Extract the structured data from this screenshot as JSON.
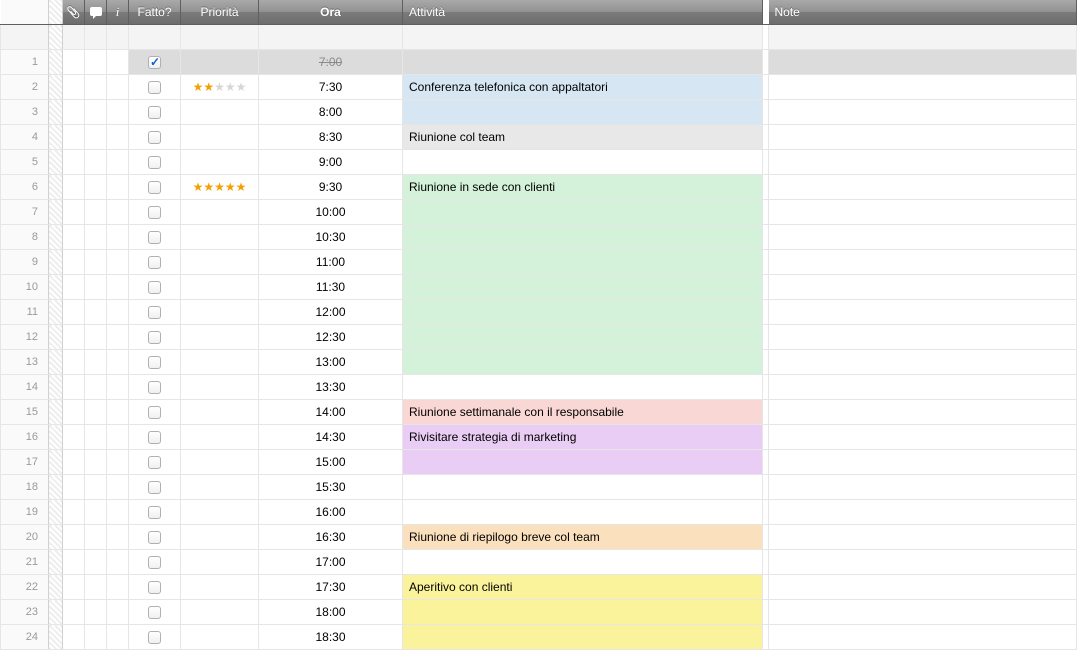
{
  "headers": {
    "done": "Fatto?",
    "priority": "Priorità",
    "time": "Ora",
    "activity": "Attività",
    "notes": "Note"
  },
  "rows": [
    {
      "n": 1,
      "checked": true,
      "stars": 0,
      "time": "7:00",
      "strike": true,
      "activity": "",
      "color": "gray",
      "note": ""
    },
    {
      "n": 2,
      "checked": false,
      "stars": 2,
      "time": "7:30",
      "strike": false,
      "activity": "Conferenza telefonica con appaltatori",
      "color": "blue",
      "note": ""
    },
    {
      "n": 3,
      "checked": false,
      "stars": 0,
      "time": "8:00",
      "strike": false,
      "activity": "",
      "color": "blue",
      "note": ""
    },
    {
      "n": 4,
      "checked": false,
      "stars": 0,
      "time": "8:30",
      "strike": false,
      "activity": "Riunione col team",
      "color": "ltgray",
      "note": ""
    },
    {
      "n": 5,
      "checked": false,
      "stars": 0,
      "time": "9:00",
      "strike": false,
      "activity": "",
      "color": "",
      "note": ""
    },
    {
      "n": 6,
      "checked": false,
      "stars": 5,
      "time": "9:30",
      "strike": false,
      "activity": "Riunione in sede con clienti",
      "color": "green",
      "note": ""
    },
    {
      "n": 7,
      "checked": false,
      "stars": 0,
      "time": "10:00",
      "strike": false,
      "activity": "",
      "color": "green",
      "note": ""
    },
    {
      "n": 8,
      "checked": false,
      "stars": 0,
      "time": "10:30",
      "strike": false,
      "activity": "",
      "color": "green",
      "note": ""
    },
    {
      "n": 9,
      "checked": false,
      "stars": 0,
      "time": "11:00",
      "strike": false,
      "activity": "",
      "color": "green",
      "note": ""
    },
    {
      "n": 10,
      "checked": false,
      "stars": 0,
      "time": "11:30",
      "strike": false,
      "activity": "",
      "color": "green",
      "note": ""
    },
    {
      "n": 11,
      "checked": false,
      "stars": 0,
      "time": "12:00",
      "strike": false,
      "activity": "",
      "color": "green",
      "note": ""
    },
    {
      "n": 12,
      "checked": false,
      "stars": 0,
      "time": "12:30",
      "strike": false,
      "activity": "",
      "color": "green",
      "note": ""
    },
    {
      "n": 13,
      "checked": false,
      "stars": 0,
      "time": "13:00",
      "strike": false,
      "activity": "",
      "color": "green",
      "note": ""
    },
    {
      "n": 14,
      "checked": false,
      "stars": 0,
      "time": "13:30",
      "strike": false,
      "activity": "",
      "color": "",
      "note": ""
    },
    {
      "n": 15,
      "checked": false,
      "stars": 0,
      "time": "14:00",
      "strike": false,
      "activity": "Riunione settimanale con il responsabile",
      "color": "pink",
      "note": ""
    },
    {
      "n": 16,
      "checked": false,
      "stars": 0,
      "time": "14:30",
      "strike": false,
      "activity": "Rivisitare strategia di marketing",
      "color": "purple",
      "note": ""
    },
    {
      "n": 17,
      "checked": false,
      "stars": 0,
      "time": "15:00",
      "strike": false,
      "activity": "",
      "color": "purple",
      "note": ""
    },
    {
      "n": 18,
      "checked": false,
      "stars": 0,
      "time": "15:30",
      "strike": false,
      "activity": "",
      "color": "",
      "note": ""
    },
    {
      "n": 19,
      "checked": false,
      "stars": 0,
      "time": "16:00",
      "strike": false,
      "activity": "",
      "color": "",
      "note": ""
    },
    {
      "n": 20,
      "checked": false,
      "stars": 0,
      "time": "16:30",
      "strike": false,
      "activity": "Riunione di riepilogo breve col team",
      "color": "orange",
      "note": ""
    },
    {
      "n": 21,
      "checked": false,
      "stars": 0,
      "time": "17:00",
      "strike": false,
      "activity": "",
      "color": "",
      "note": ""
    },
    {
      "n": 22,
      "checked": false,
      "stars": 0,
      "time": "17:30",
      "strike": false,
      "activity": "Aperitivo con clienti",
      "color": "yellow",
      "note": ""
    },
    {
      "n": 23,
      "checked": false,
      "stars": 0,
      "time": "18:00",
      "strike": false,
      "activity": "",
      "color": "yellow",
      "note": ""
    },
    {
      "n": 24,
      "checked": false,
      "stars": 0,
      "time": "18:30",
      "strike": false,
      "activity": "",
      "color": "yellow",
      "note": ""
    }
  ]
}
